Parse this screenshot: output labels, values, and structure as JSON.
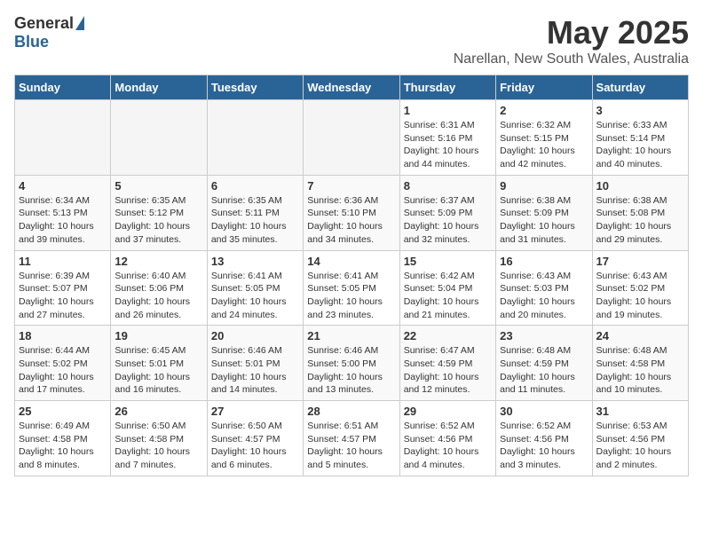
{
  "logo": {
    "general": "General",
    "blue": "Blue"
  },
  "header": {
    "month": "May 2025",
    "location": "Narellan, New South Wales, Australia"
  },
  "weekdays": [
    "Sunday",
    "Monday",
    "Tuesday",
    "Wednesday",
    "Thursday",
    "Friday",
    "Saturday"
  ],
  "weeks": [
    [
      {
        "day": "",
        "info": ""
      },
      {
        "day": "",
        "info": ""
      },
      {
        "day": "",
        "info": ""
      },
      {
        "day": "",
        "info": ""
      },
      {
        "day": "1",
        "info": "Sunrise: 6:31 AM\nSunset: 5:16 PM\nDaylight: 10 hours\nand 44 minutes."
      },
      {
        "day": "2",
        "info": "Sunrise: 6:32 AM\nSunset: 5:15 PM\nDaylight: 10 hours\nand 42 minutes."
      },
      {
        "day": "3",
        "info": "Sunrise: 6:33 AM\nSunset: 5:14 PM\nDaylight: 10 hours\nand 40 minutes."
      }
    ],
    [
      {
        "day": "4",
        "info": "Sunrise: 6:34 AM\nSunset: 5:13 PM\nDaylight: 10 hours\nand 39 minutes."
      },
      {
        "day": "5",
        "info": "Sunrise: 6:35 AM\nSunset: 5:12 PM\nDaylight: 10 hours\nand 37 minutes."
      },
      {
        "day": "6",
        "info": "Sunrise: 6:35 AM\nSunset: 5:11 PM\nDaylight: 10 hours\nand 35 minutes."
      },
      {
        "day": "7",
        "info": "Sunrise: 6:36 AM\nSunset: 5:10 PM\nDaylight: 10 hours\nand 34 minutes."
      },
      {
        "day": "8",
        "info": "Sunrise: 6:37 AM\nSunset: 5:09 PM\nDaylight: 10 hours\nand 32 minutes."
      },
      {
        "day": "9",
        "info": "Sunrise: 6:38 AM\nSunset: 5:09 PM\nDaylight: 10 hours\nand 31 minutes."
      },
      {
        "day": "10",
        "info": "Sunrise: 6:38 AM\nSunset: 5:08 PM\nDaylight: 10 hours\nand 29 minutes."
      }
    ],
    [
      {
        "day": "11",
        "info": "Sunrise: 6:39 AM\nSunset: 5:07 PM\nDaylight: 10 hours\nand 27 minutes."
      },
      {
        "day": "12",
        "info": "Sunrise: 6:40 AM\nSunset: 5:06 PM\nDaylight: 10 hours\nand 26 minutes."
      },
      {
        "day": "13",
        "info": "Sunrise: 6:41 AM\nSunset: 5:05 PM\nDaylight: 10 hours\nand 24 minutes."
      },
      {
        "day": "14",
        "info": "Sunrise: 6:41 AM\nSunset: 5:05 PM\nDaylight: 10 hours\nand 23 minutes."
      },
      {
        "day": "15",
        "info": "Sunrise: 6:42 AM\nSunset: 5:04 PM\nDaylight: 10 hours\nand 21 minutes."
      },
      {
        "day": "16",
        "info": "Sunrise: 6:43 AM\nSunset: 5:03 PM\nDaylight: 10 hours\nand 20 minutes."
      },
      {
        "day": "17",
        "info": "Sunrise: 6:43 AM\nSunset: 5:02 PM\nDaylight: 10 hours\nand 19 minutes."
      }
    ],
    [
      {
        "day": "18",
        "info": "Sunrise: 6:44 AM\nSunset: 5:02 PM\nDaylight: 10 hours\nand 17 minutes."
      },
      {
        "day": "19",
        "info": "Sunrise: 6:45 AM\nSunset: 5:01 PM\nDaylight: 10 hours\nand 16 minutes."
      },
      {
        "day": "20",
        "info": "Sunrise: 6:46 AM\nSunset: 5:01 PM\nDaylight: 10 hours\nand 14 minutes."
      },
      {
        "day": "21",
        "info": "Sunrise: 6:46 AM\nSunset: 5:00 PM\nDaylight: 10 hours\nand 13 minutes."
      },
      {
        "day": "22",
        "info": "Sunrise: 6:47 AM\nSunset: 4:59 PM\nDaylight: 10 hours\nand 12 minutes."
      },
      {
        "day": "23",
        "info": "Sunrise: 6:48 AM\nSunset: 4:59 PM\nDaylight: 10 hours\nand 11 minutes."
      },
      {
        "day": "24",
        "info": "Sunrise: 6:48 AM\nSunset: 4:58 PM\nDaylight: 10 hours\nand 10 minutes."
      }
    ],
    [
      {
        "day": "25",
        "info": "Sunrise: 6:49 AM\nSunset: 4:58 PM\nDaylight: 10 hours\nand 8 minutes."
      },
      {
        "day": "26",
        "info": "Sunrise: 6:50 AM\nSunset: 4:58 PM\nDaylight: 10 hours\nand 7 minutes."
      },
      {
        "day": "27",
        "info": "Sunrise: 6:50 AM\nSunset: 4:57 PM\nDaylight: 10 hours\nand 6 minutes."
      },
      {
        "day": "28",
        "info": "Sunrise: 6:51 AM\nSunset: 4:57 PM\nDaylight: 10 hours\nand 5 minutes."
      },
      {
        "day": "29",
        "info": "Sunrise: 6:52 AM\nSunset: 4:56 PM\nDaylight: 10 hours\nand 4 minutes."
      },
      {
        "day": "30",
        "info": "Sunrise: 6:52 AM\nSunset: 4:56 PM\nDaylight: 10 hours\nand 3 minutes."
      },
      {
        "day": "31",
        "info": "Sunrise: 6:53 AM\nSunset: 4:56 PM\nDaylight: 10 hours\nand 2 minutes."
      }
    ]
  ]
}
